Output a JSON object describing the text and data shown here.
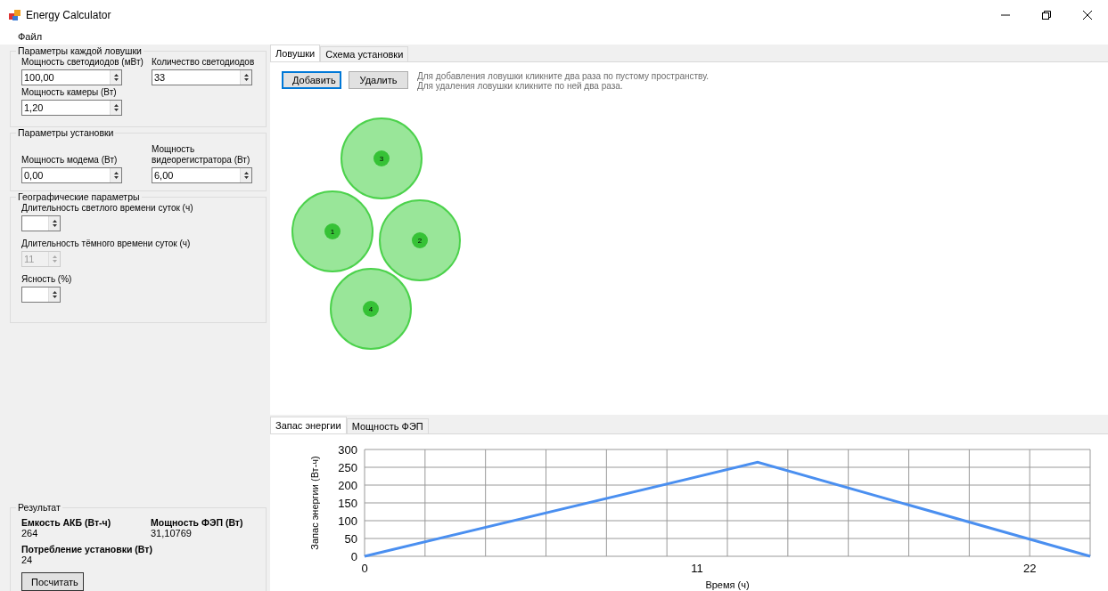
{
  "window": {
    "title": "Energy Calculator"
  },
  "menu": [
    {
      "label": "Файл"
    }
  ],
  "groups": [
    {
      "title": "Параметры  каждой ловушки",
      "fields": [
        {
          "label": "Мощность светодиодов (мВт)",
          "value": "100,00",
          "disabled": false,
          "kind": "wide"
        },
        {
          "label": "Количество светодиодов",
          "value": "33",
          "disabled": false,
          "kind": "wide"
        },
        {
          "label": "Мощность камеры (Вт)",
          "value": "1,20",
          "disabled": false,
          "kind": "wide"
        }
      ]
    },
    {
      "title": "Параметры установки",
      "fields": [
        {
          "label": "Мощность модема (Вт)",
          "value": "0,00",
          "disabled": false,
          "kind": "wide"
        },
        {
          "label": "Мощность видеорегистратора (Вт)",
          "value": "6,00",
          "disabled": false,
          "kind": "wide"
        }
      ]
    },
    {
      "title": "Географические параметры",
      "fields": [
        {
          "label": "Длительность светлого времени суток (ч)",
          "disabled": false,
          "kind": "small"
        },
        {
          "label": "Длительность тёмного времени суток (ч)",
          "value": "11",
          "disabled": true,
          "kind": "small"
        },
        {
          "label": "Ясность (%)",
          "disabled": false,
          "kind": "small"
        }
      ]
    }
  ],
  "result": {
    "title": "Результат",
    "items": [
      {
        "label": "Емкость АКБ (Вт-ч)",
        "value": "264"
      },
      {
        "label": "Мощность ФЭП (Вт)",
        "value": "31,10769"
      },
      {
        "label": "Потребление установки (Вт)",
        "value": "24"
      }
    ],
    "button": "Посчитать"
  },
  "top_tabs": [
    {
      "label": "Ловушки",
      "selected": true
    },
    {
      "label": "Схема установки",
      "selected": false
    }
  ],
  "traps_panel": {
    "buttons": [
      {
        "label": "Добавить",
        "focused": true
      },
      {
        "label": "Удалить",
        "focused": false
      }
    ],
    "hints": [
      "Для добавления ловушки кликните два раза по пустому пространству.",
      "Для удаления ловушки кликните по ней два раза."
    ],
    "traps": [
      {
        "label": "3"
      },
      {
        "label": "1"
      },
      {
        "label": "2"
      },
      {
        "label": "4"
      }
    ]
  },
  "bottom_tabs": [
    {
      "label": "Запас энергии",
      "selected": true
    },
    {
      "label": "Мощность ФЭП",
      "selected": false
    }
  ],
  "chart": {
    "chart_data": {
      "type": "line",
      "xlabel": "Время (ч)",
      "ylabel": "Запас энергии (Вт-ч)",
      "x": [
        0,
        13,
        24
      ],
      "series": [
        {
          "color": "#4a8ff0",
          "values": [
            0,
            264,
            0
          ]
        }
      ],
      "grid": true,
      "xlim": [
        0,
        24
      ],
      "ylim": [
        0,
        300
      ],
      "xticks": [
        0,
        11,
        22
      ],
      "yticks": [
        0,
        50,
        100,
        150,
        200,
        250,
        300
      ]
    }
  }
}
